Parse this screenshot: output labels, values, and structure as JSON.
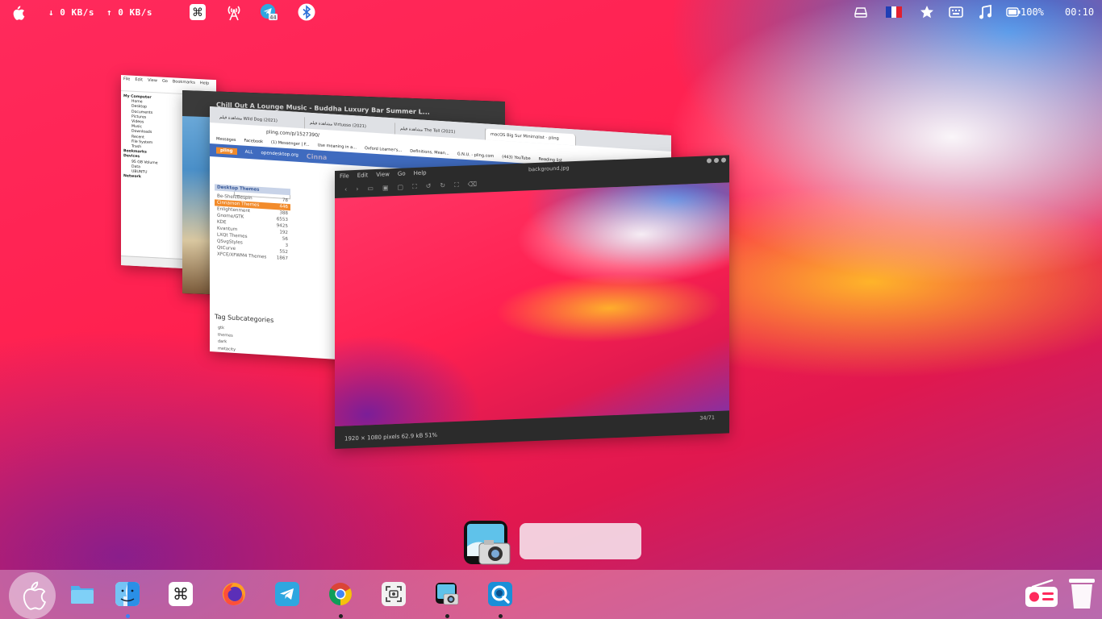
{
  "menubar": {
    "download_speed": "↓ 0 KB/s",
    "upload_speed": "↑ 0 KB/s",
    "telegram_badge": "44",
    "battery": "100%",
    "clock": "00:10"
  },
  "windows": {
    "file_manager": {
      "menu": [
        "File",
        "Edit",
        "View",
        "Go",
        "Bookmarks",
        "Help"
      ],
      "sidebar": [
        {
          "label": "My Computer",
          "header": true
        },
        {
          "label": "Home"
        },
        {
          "label": "Desktop"
        },
        {
          "label": "Documents"
        },
        {
          "label": "Pictures"
        },
        {
          "label": "Videos"
        },
        {
          "label": "Music"
        },
        {
          "label": "Downloads"
        },
        {
          "label": "Recent"
        },
        {
          "label": "File System"
        },
        {
          "label": "Trash"
        },
        {
          "label": "Bookmarks",
          "header": true
        },
        {
          "label": "Devices",
          "header": true
        },
        {
          "label": "95 GB Volume"
        },
        {
          "label": "Data"
        },
        {
          "label": "UBUNTU"
        },
        {
          "label": "Network",
          "header": true
        }
      ]
    },
    "youtube": {
      "title": "Chill Out A Lounge Music - Buddha Luxury Bar Summer L..."
    },
    "chrome": {
      "tabs": [
        {
          "label": "مشاهدة فيلم Wild Dog (2021)"
        },
        {
          "label": "مشاهدة فيلم Virtuoso (2021)"
        },
        {
          "label": "مشاهدة فيلم The Toll (2021)"
        },
        {
          "label": "macOS Big Sur Minimalist - pling",
          "active": true
        }
      ],
      "window_title": "macOS Big Sur Minimalist - pling.com - Google Chrome",
      "url": "pling.com/p/1527390/",
      "bookmarks": [
        "Messages",
        "Facebook",
        "(1) Messenger | F...",
        "Use meaning in a...",
        "Oxford Learner's...",
        "Definitions, Mean...",
        "G.N.U. - pling.com",
        "(443) YouTube"
      ],
      "reading_list": "Reading list",
      "site_logo": "pling",
      "site_filter": "ALL",
      "site_link": "opendesktop.org",
      "page_heading": "Cinna",
      "categories_header": "Desktop Themes",
      "categories": [
        {
          "name": "Be-Shell/Bespin",
          "count": "78"
        },
        {
          "name": "Cinnamon Themes",
          "count": "446",
          "selected": true
        },
        {
          "name": "Enlightenment",
          "count": "388"
        },
        {
          "name": "Gnome/GTK",
          "count": "6553"
        },
        {
          "name": "KDE",
          "count": "9425"
        },
        {
          "name": "Kvantum",
          "count": "192"
        },
        {
          "name": "LXQt Themes",
          "count": "56"
        },
        {
          "name": "QSvgStyles",
          "count": "3"
        },
        {
          "name": "QtCurve",
          "count": "552"
        },
        {
          "name": "XFCE/XFWM4 Themes",
          "count": "1867"
        }
      ],
      "tag_subcategories_label": "Tag Subcategories",
      "tags": [
        "gtk",
        "themes",
        "dark",
        "metacity"
      ]
    },
    "image_viewer": {
      "menu": [
        "File",
        "Edit",
        "View",
        "Go",
        "Help"
      ],
      "title": "background.jpg",
      "status": "1920 × 1080 pixels  62.9 kB   51%",
      "counter": "34/71"
    }
  },
  "colors": {
    "accent_blue": "#2a7fd4",
    "selection_orange": "#f28b2b",
    "dock_indicator": "#3b82f6"
  },
  "dock": {
    "items": [
      "apple-menu",
      "files",
      "finder",
      "command",
      "firefox",
      "telegram",
      "chrome",
      "screenshot",
      "image-viewer",
      "quicktime",
      "radio",
      "trash"
    ]
  }
}
